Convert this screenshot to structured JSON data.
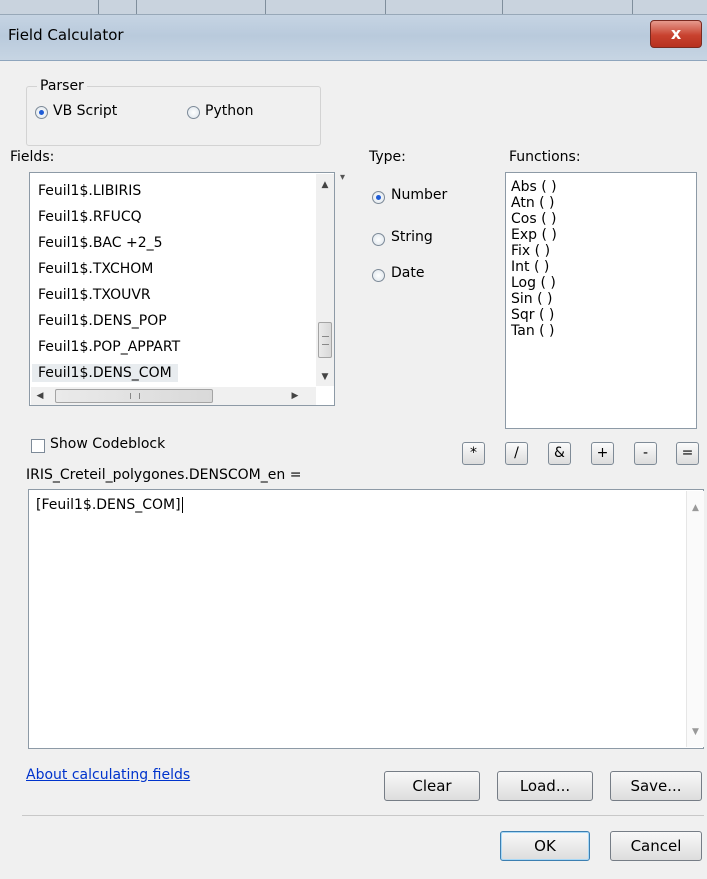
{
  "window": {
    "title": "Field Calculator",
    "close_label": "x"
  },
  "parser": {
    "legend": "Parser",
    "options": [
      {
        "label": "VB Script",
        "selected": true
      },
      {
        "label": "Python",
        "selected": false
      }
    ]
  },
  "fields": {
    "label": "Fields:",
    "items": [
      "Feuil1$.LIBIRIS",
      "Feuil1$.RFUCQ",
      "Feuil1$.BAC +2_5",
      "Feuil1$.TXCHOM",
      "Feuil1$.TXOUVR",
      "Feuil1$.DENS_POP",
      "Feuil1$.POP_APPART",
      "Feuil1$.DENS_COM"
    ],
    "selected_index": 7
  },
  "type": {
    "label": "Type:",
    "options": [
      {
        "label": "Number",
        "selected": true
      },
      {
        "label": "String",
        "selected": false
      },
      {
        "label": "Date",
        "selected": false
      }
    ]
  },
  "functions": {
    "label": "Functions:",
    "items": [
      "Abs ( )",
      "Atn ( )",
      "Cos ( )",
      "Exp ( )",
      "Fix ( )",
      "Int ( )",
      "Log ( )",
      "Sin ( )",
      "Sqr ( )",
      "Tan ( )"
    ]
  },
  "show_codeblock": {
    "label": "Show Codeblock",
    "checked": false
  },
  "operators": [
    "*",
    "/",
    "&",
    "+",
    "-",
    "="
  ],
  "expression": {
    "target": "IRIS_Creteil_polygones.DENSCOM_en =",
    "value": "[Feuil1$.DENS_COM]"
  },
  "link": "About calculating fields",
  "buttons": {
    "clear": "Clear",
    "load": "Load...",
    "save": "Save...",
    "ok": "OK",
    "cancel": "Cancel"
  },
  "icons": {
    "close": "close-icon",
    "scroll_up": "arrow-up-icon",
    "scroll_down": "arrow-down-icon",
    "scroll_left": "arrow-left-icon",
    "scroll_right": "arrow-right-icon",
    "grip": "scroll-grip-icon"
  }
}
